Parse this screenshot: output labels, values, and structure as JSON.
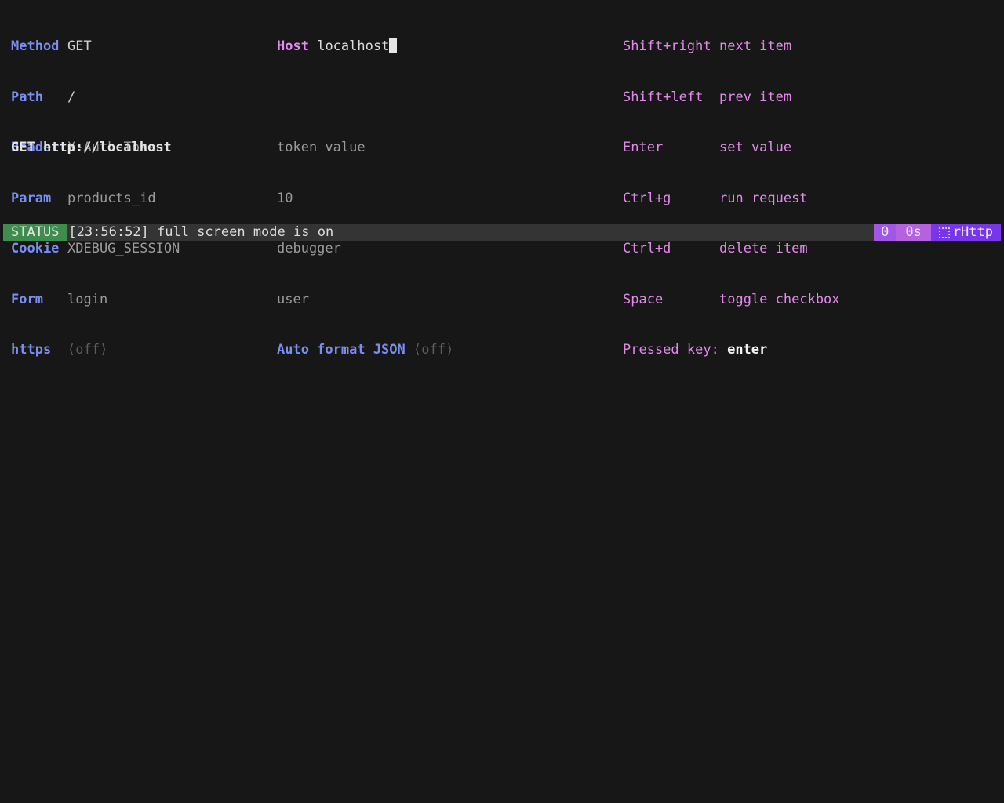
{
  "request_fields": [
    {
      "label": "Method",
      "value": "GET",
      "style": "main"
    },
    {
      "label": "Path",
      "value": "/",
      "style": "main"
    },
    {
      "label": "Header",
      "value": "X-Auth-Token",
      "style": "dim"
    },
    {
      "label": "Param",
      "value": "products_id",
      "style": "dim"
    },
    {
      "label": "Cookie",
      "value": "XDEBUG_SESSION",
      "style": "dim"
    },
    {
      "label": "Form",
      "value": "login",
      "style": "dim"
    },
    {
      "label": "https",
      "value": "⟨off⟩",
      "style": "off"
    }
  ],
  "host": {
    "label": "Host",
    "value": "localhost"
  },
  "field_values": [
    "token value",
    "10",
    "debugger",
    "user"
  ],
  "auto_format": {
    "label": "Auto format JSON",
    "value": "⟨off⟩"
  },
  "shortcuts": [
    {
      "key": "Shift+right",
      "desc": "next item"
    },
    {
      "key": "Shift+left",
      "desc": "prev item"
    },
    {
      "key": "Enter",
      "desc": "set value"
    },
    {
      "key": "Ctrl+g",
      "desc": "run request"
    },
    {
      "key": "Ctrl+d",
      "desc": "delete item"
    },
    {
      "key": "Space",
      "desc": "toggle checkbox"
    }
  ],
  "pressed": {
    "label": "Pressed key:",
    "value": "enter"
  },
  "request_line": "GET http://localhost",
  "status": {
    "badge": "STATUS",
    "message": "[23:56:52] full screen mode is on",
    "count": "0",
    "time": "0s",
    "app_name": "rHttp",
    "app_icon": "grid-icon"
  },
  "colors": {
    "background": "#171717",
    "label_blue": "#7b8ef0",
    "accent_pink": "#e08ae8",
    "status_green": "#3e8d4e",
    "status_bar": "#343434",
    "purple": "#7836e8"
  }
}
